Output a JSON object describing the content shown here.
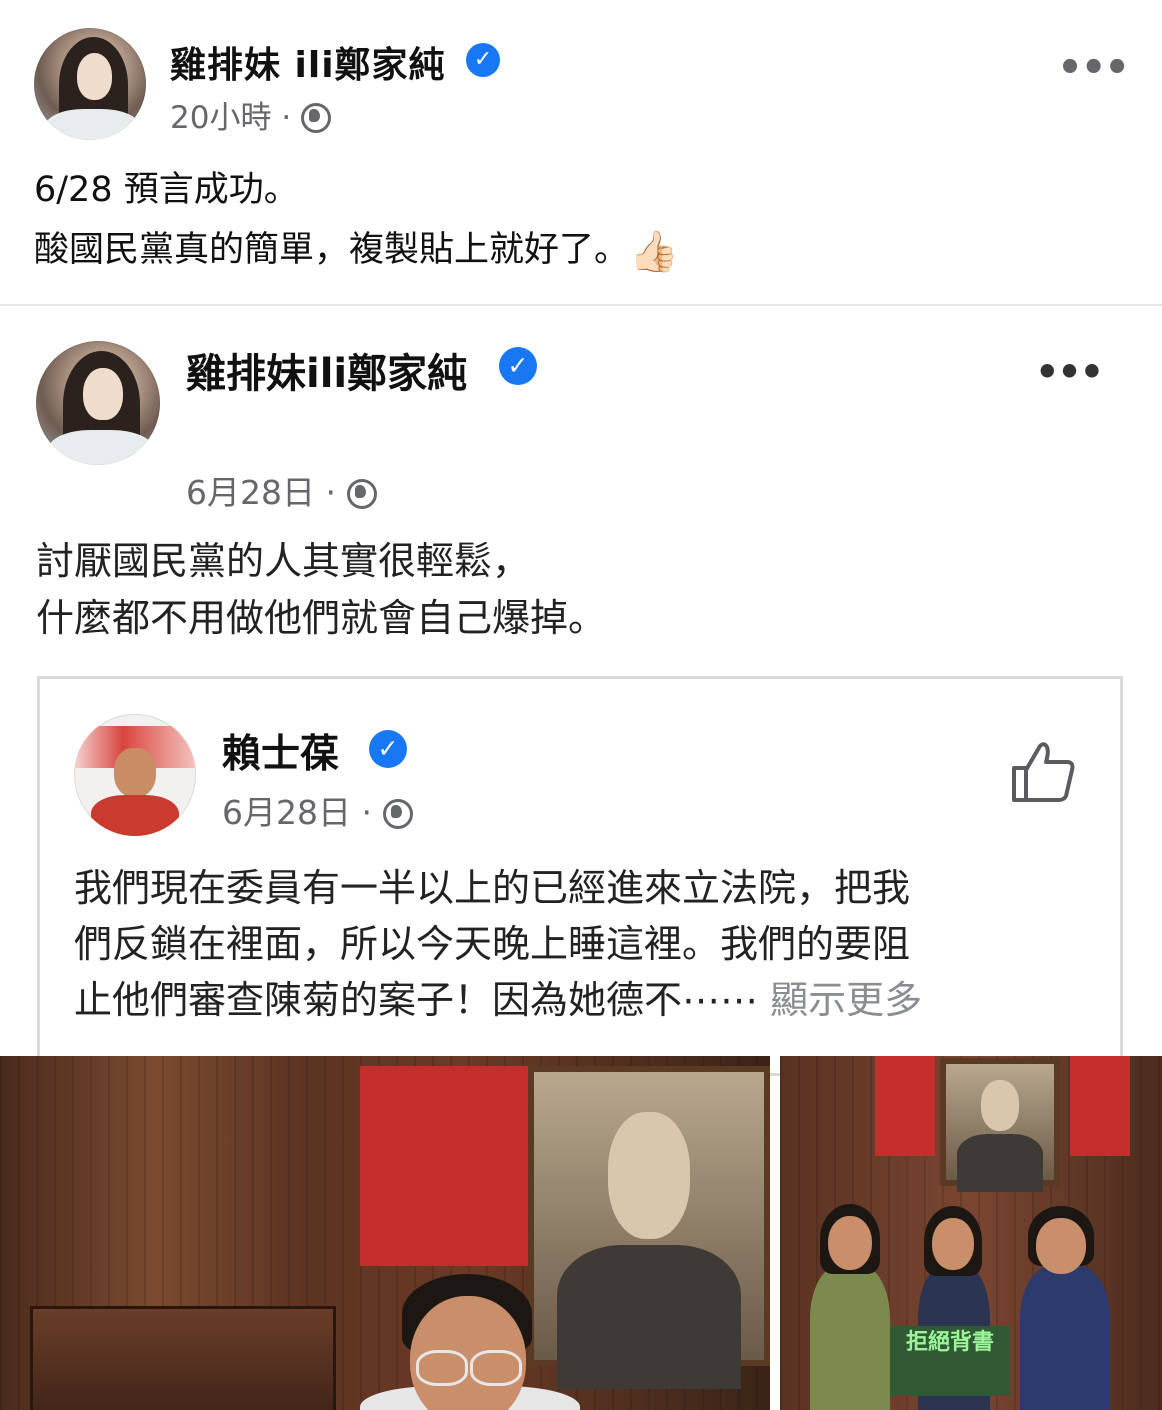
{
  "post": {
    "author": "雞排妹 ili鄭家純",
    "verified_mark": "✓",
    "time": "20小時",
    "separator": "·",
    "more": "•••",
    "text_lines": [
      "6/28 預言成功。",
      "酸國民黨真的簡單，複製貼上就好了。"
    ],
    "emoji": "👍🏻"
  },
  "shared_post": {
    "author": "雞排妹ili鄭家純",
    "verified_mark": "✓",
    "date": "6月28日",
    "separator": "·",
    "more": "•••",
    "text_lines": [
      "討厭國民黨的人其實很輕鬆，",
      "什麼都不用做他們就會自己爆掉。"
    ]
  },
  "quoted_post": {
    "author": "賴士葆",
    "verified_mark": "✓",
    "date": "6月28日",
    "separator": "·",
    "text_lines": [
      "我們現在委員有一半以上的已經進來立法院，把我",
      "們反鎖在裡面，所以今天晚上睡這裡。我們的要阻",
      "止他們審查陳菊的案子！因為她德不⋯⋯"
    ],
    "see_more": "顯示更多"
  },
  "photos": {
    "right_sign_text": "拒絕背書"
  },
  "icons": {
    "verified": "verified-badge-icon",
    "globe": "globe-icon",
    "more": "more-options-icon",
    "like": "thumbs-up-icon"
  },
  "colors": {
    "verified": "#1877f2",
    "meta": "#65676b",
    "divider": "#e4e6eb"
  }
}
